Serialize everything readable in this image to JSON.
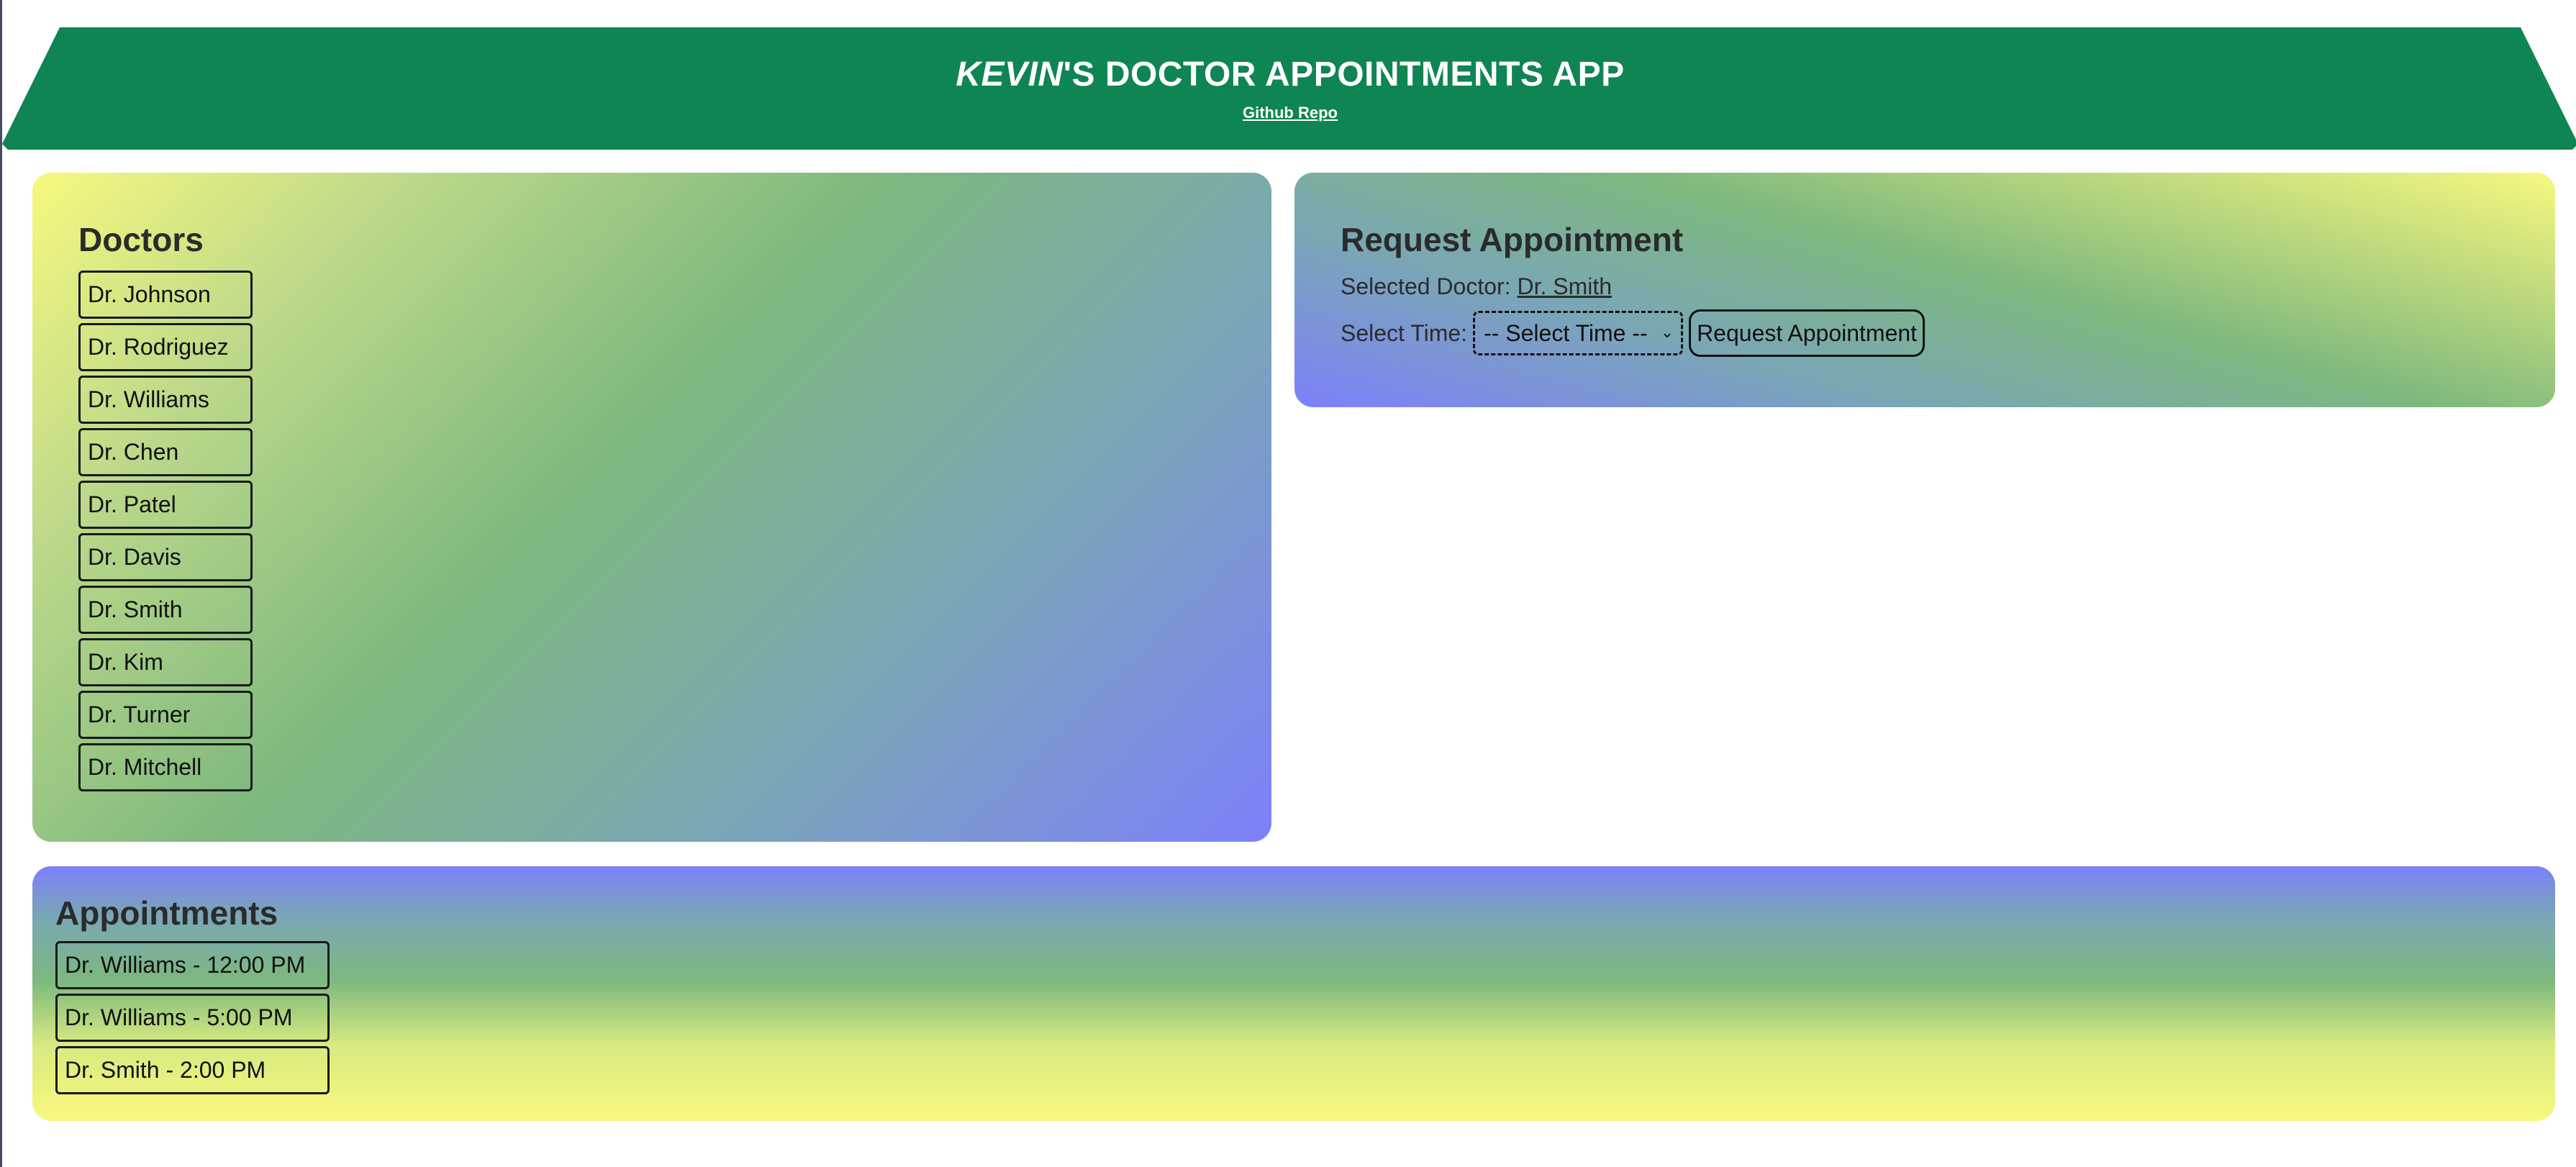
{
  "header": {
    "title_italic": "KEVIN",
    "title_rest": "'S DOCTOR APPOINTMENTS APP",
    "repo_link": "Github Repo",
    "color": "#0e8553"
  },
  "doctors": {
    "title": "Doctors",
    "items": [
      "Dr. Johnson",
      "Dr. Rodriguez",
      "Dr. Williams",
      "Dr. Chen",
      "Dr. Patel",
      "Dr. Davis",
      "Dr. Smith",
      "Dr. Kim",
      "Dr. Turner",
      "Dr. Mitchell"
    ]
  },
  "request": {
    "title": "Request Appointment",
    "selected_label": "Selected Doctor:",
    "selected_doctor": "Dr. Smith",
    "time_label": "Select Time:",
    "time_select_value": "-- Select Time --",
    "button_label": "Request Appointment"
  },
  "appointments": {
    "title": "Appointments",
    "items": [
      "Dr. Williams - 12:00 PM",
      "Dr. Williams - 5:00 PM",
      "Dr. Smith - 2:00 PM"
    ]
  },
  "colors": {
    "yellow": "#f8f87e",
    "green": "#7db87e",
    "blue": "#7d80fb"
  }
}
